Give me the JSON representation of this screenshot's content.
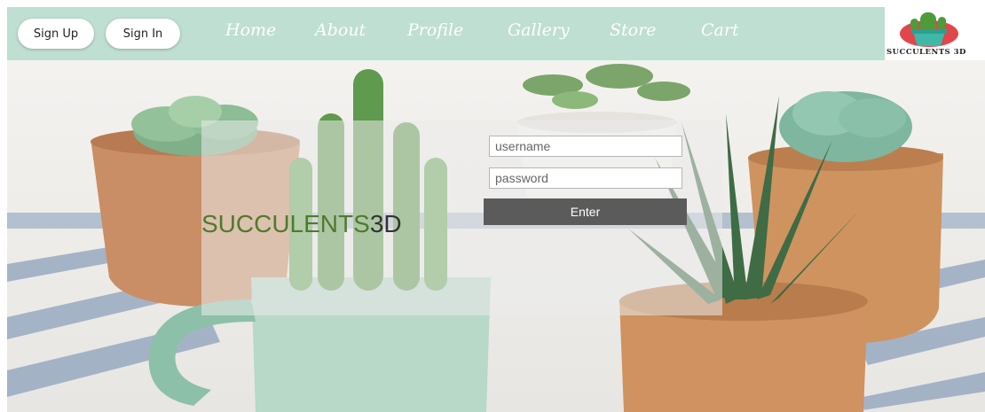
{
  "auth_buttons": {
    "sign_up": "Sign Up",
    "sign_in": "Sign In"
  },
  "nav": {
    "home": "Home",
    "about": "About",
    "profile": "Profile",
    "gallery": "Gallery",
    "store": "Store",
    "cart": "Cart"
  },
  "logo": {
    "text": "SUCCULENTS 3D",
    "icon": "cactus-pot-icon"
  },
  "login": {
    "brand_main": "SUCCULENTS",
    "brand_suffix": "3D",
    "username_placeholder": "username",
    "password_placeholder": "password",
    "enter_label": "Enter"
  },
  "colors": {
    "navbar": "#bedfd1",
    "brand_green": "#4f7a2d",
    "button_gray": "#5b5b5b"
  }
}
